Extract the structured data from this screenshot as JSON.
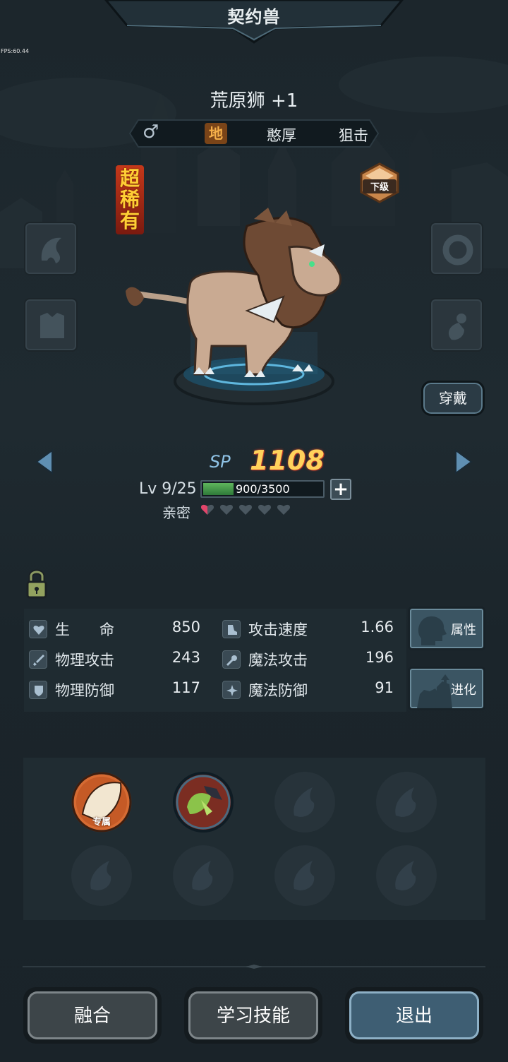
{
  "header": {
    "title": "契约兽"
  },
  "debug": {
    "fps": "FPS:60.44"
  },
  "pet": {
    "name": "荒原狮 +1",
    "gender_icon": "male-symbol",
    "gender_symbol": "♂",
    "element": "地",
    "personality": "憨厚",
    "role": "狙击",
    "rarity_chars": [
      "超",
      "稀",
      "有"
    ],
    "grade": "下级"
  },
  "equipment": {
    "left_slots": [
      "horn-armor-icon",
      "body-armor-icon"
    ],
    "right_slots": [
      "ring-icon",
      "amulet-icon"
    ],
    "equip_label": "穿戴"
  },
  "progress": {
    "sp_label": "SP",
    "sp_value": "1108",
    "level_text": "Lv 9/25",
    "exp_text": "900/3500",
    "exp_current": 900,
    "exp_max": 3500,
    "intimacy_label": "亲密",
    "intimacy_filled": 0.5,
    "intimacy_max": 5
  },
  "stats": {
    "rows": [
      {
        "left": {
          "icon": "heart-icon",
          "name": "生　　命",
          "value": "850"
        },
        "right": {
          "icon": "boot-icon",
          "name": "攻击速度",
          "value": "1.66"
        }
      },
      {
        "left": {
          "icon": "sword-icon",
          "name": "物理攻击",
          "value": "243"
        },
        "right": {
          "icon": "staff-icon",
          "name": "魔法攻击",
          "value": "196"
        }
      },
      {
        "left": {
          "icon": "shield-icon",
          "name": "物理防御",
          "value": "117"
        },
        "right": {
          "icon": "star-icon",
          "name": "魔法防御",
          "value": "91"
        }
      }
    ]
  },
  "side_buttons": {
    "attributes": "属性",
    "evolve": "进化"
  },
  "skills": {
    "exclusive_tag": "专属",
    "slots": [
      "exclusive-skill",
      "nature-skill",
      "empty",
      "empty",
      "empty",
      "empty",
      "empty",
      "empty"
    ]
  },
  "actions": {
    "fuse": "融合",
    "learn": "学习技能",
    "exit": "退出"
  },
  "colors": {
    "accent_gold": "#ffd25c",
    "sp_blue": "#8fc3e6",
    "exp_green": "#4fa551",
    "element_bg": "#7a4418"
  }
}
